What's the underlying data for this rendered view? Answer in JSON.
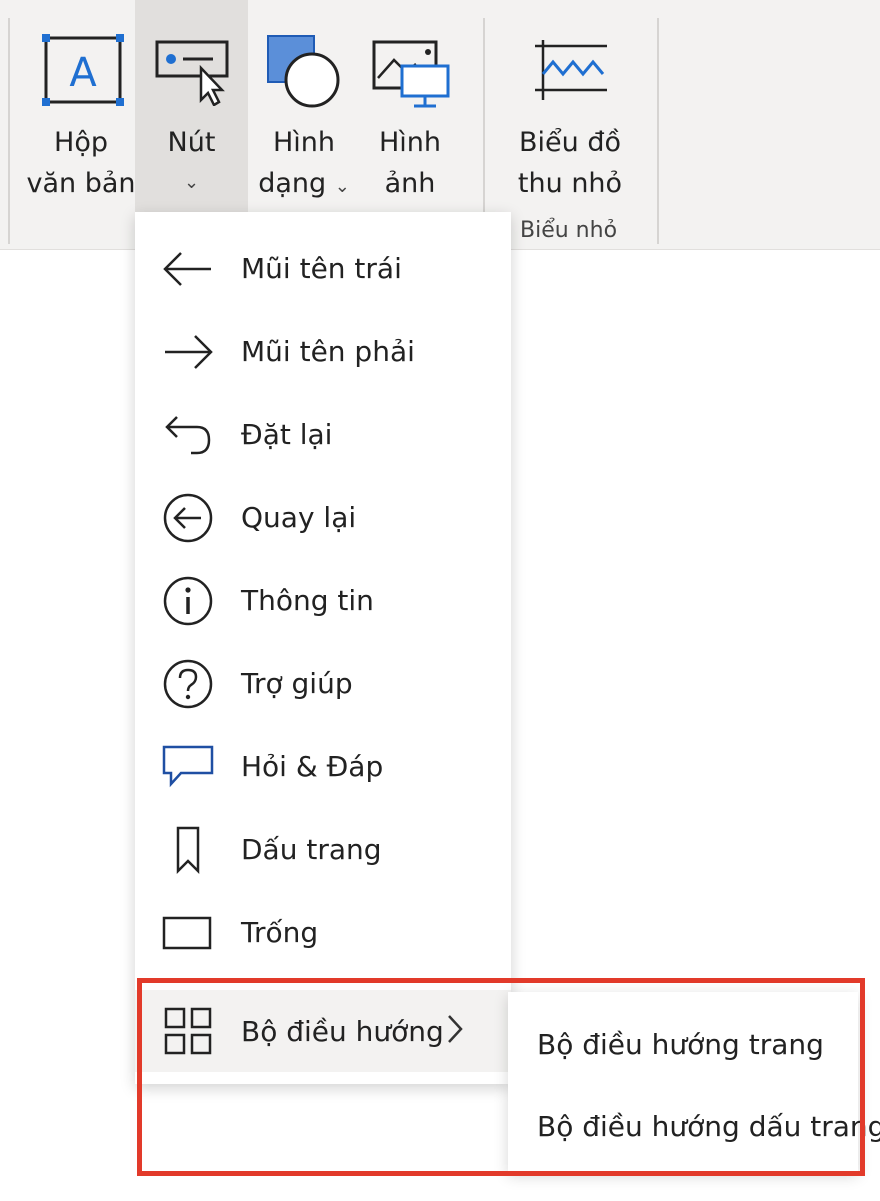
{
  "ribbon": {
    "textbox": {
      "line1": "Hộp",
      "line2": "văn bản"
    },
    "button": {
      "line1": "Nút",
      "chevron": "⌄"
    },
    "shapes": {
      "line1": "Hình",
      "line2": "dạng",
      "chevron": "⌄"
    },
    "image": {
      "line1": "Hình",
      "line2": "ảnh"
    },
    "sparkline": {
      "line1": "Biểu đồ",
      "line2": "thu nhỏ"
    },
    "group_label": "Biểu nhỏ"
  },
  "menu": {
    "items": [
      {
        "label": "Mũi tên trái",
        "icon": "arrow-left-icon"
      },
      {
        "label": "Mũi tên phải",
        "icon": "arrow-right-icon"
      },
      {
        "label": "Đặt lại",
        "icon": "reset-icon"
      },
      {
        "label": "Quay lại",
        "icon": "back-icon"
      },
      {
        "label": "Thông tin",
        "icon": "info-icon"
      },
      {
        "label": "Trợ giúp",
        "icon": "help-icon"
      },
      {
        "label": "Hỏi & Đáp",
        "icon": "qna-icon"
      },
      {
        "label": "Dấu trang",
        "icon": "bookmark-icon"
      },
      {
        "label": "Trống",
        "icon": "blank-icon"
      },
      {
        "label": "Bộ điều hướng",
        "icon": "navigator-icon"
      }
    ]
  },
  "submenu": {
    "items": [
      {
        "label": "Bộ điều hướng trang"
      },
      {
        "label": "Bộ điều hướng dấu trang"
      }
    ]
  },
  "colors": {
    "highlight": "#e23a2a",
    "accent": "#1f6fd1"
  }
}
